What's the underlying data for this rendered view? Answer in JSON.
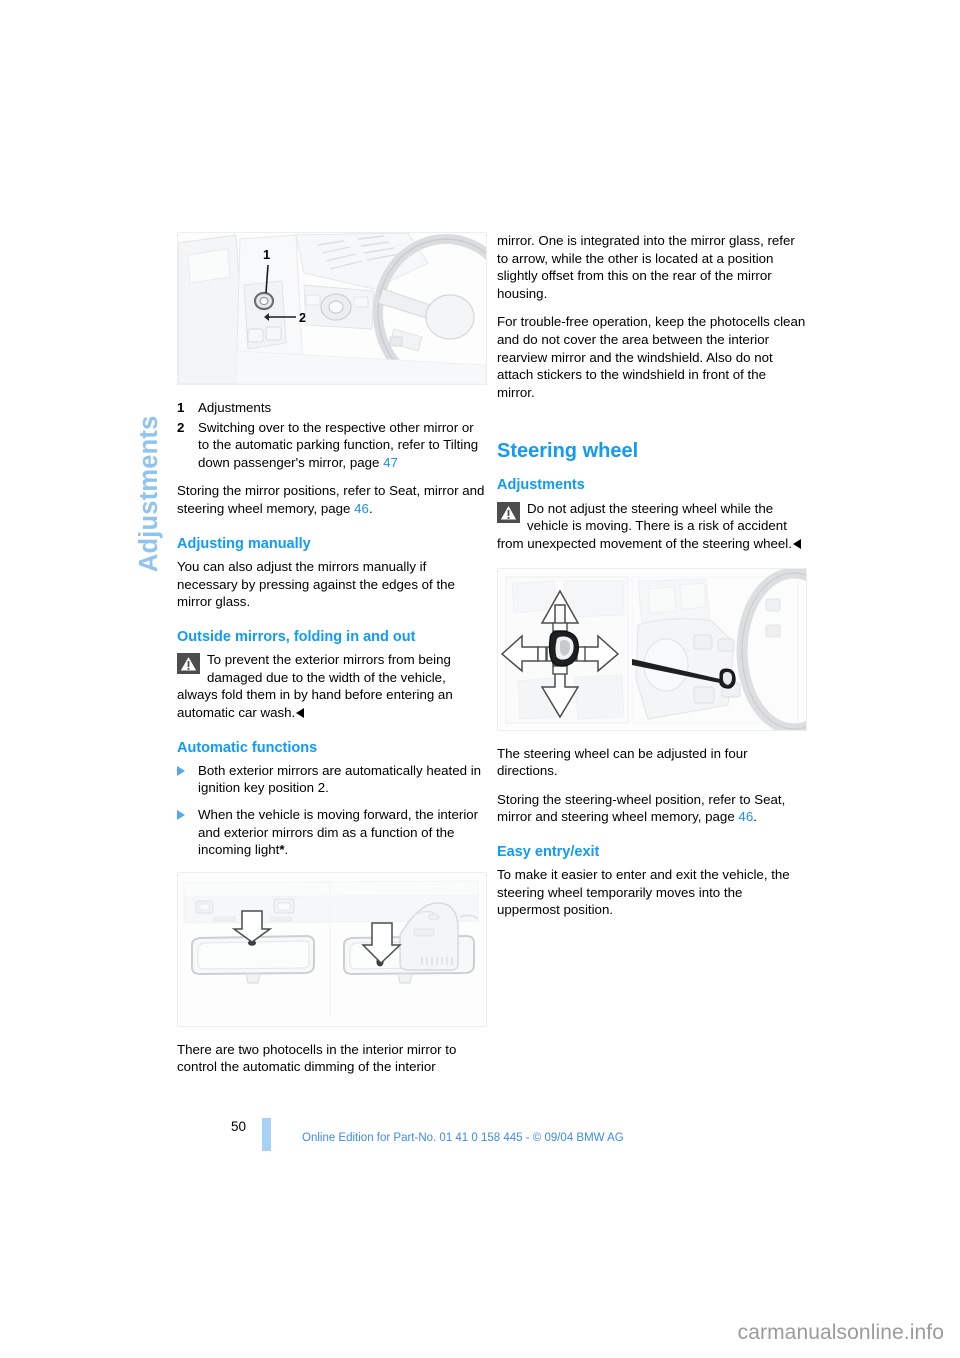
{
  "chapter": {
    "tab_label": "Adjustments"
  },
  "figures": {
    "mirror_controls": {
      "name": "mirror-control-switch-illustration",
      "callout_1": "1",
      "callout_2": "2",
      "watermark": ""
    },
    "steering_wheel_adjust": {
      "name": "steering-wheel-adjustment-illustration",
      "watermark": ""
    },
    "interior_mirror_photocells": {
      "name": "interior-mirror-photocells-illustration",
      "watermark": ""
    }
  },
  "left_column": {
    "legend": [
      {
        "num": "1",
        "text": "Adjustments"
      },
      {
        "num": "2",
        "text": "Switching over to the respective other mirror or to the automatic parking function, refer to Tilting down passenger's mirror, page ",
        "pageref": "47",
        "tail": ""
      }
    ],
    "storing_paragraph": {
      "before": "Storing the mirror positions, refer to Seat, mirror and steering wheel memory, page ",
      "pageref": "46",
      "after": "."
    },
    "adjusting_manually": {
      "heading": "Adjusting manually",
      "body": "You can also adjust the mirrors manually if necessary by pressing against the edges of the mirror glass."
    },
    "outside_mirrors": {
      "heading": "Outside mirrors, folding in and out",
      "warning": "To prevent the exterior mirrors from being damaged due to the width of the vehicle, always fold them in by hand before entering an automatic car wash."
    },
    "automatic_functions": {
      "heading": "Automatic functions",
      "items": [
        "Both exterior mirrors are automatically heated in ignition key position 2.",
        "When the vehicle is moving forward, the interior and exterior mirrors dim as a function of the incoming light"
      ],
      "item2_asterisk": "*",
      "item2_tail": "."
    },
    "photocells_paragraph": "There are two photocells in the interior mirror to control the automatic dimming of the interior"
  },
  "right_column": {
    "continued_paragraph": "mirror. One is integrated into the mirror glass, refer to arrow, while the other is located at a position slightly offset from this on the rear of the mirror housing.",
    "trouble_free_paragraph": "For trouble-free operation, keep the photocells clean and do not cover the area between the interior rearview mirror and the windshield. Also do not attach stickers to the windshield in front of the mirror.",
    "steering_wheel": {
      "heading": "Steering wheel",
      "adjustments_heading": "Adjustments",
      "warning": "Do not adjust the steering wheel while the vehicle is moving. There is a risk of accident from unexpected movement of the steering wheel.",
      "four_directions": "The steering wheel can be adjusted in four directions.",
      "storing": {
        "before": "Storing the steering-wheel position, refer to Seat, mirror and steering wheel memory, page ",
        "pageref": "46",
        "after": "."
      },
      "easy_entry": {
        "heading": "Easy entry/exit",
        "body": "To make it easier to enter and exit the vehicle, the steering wheel temporarily moves into the uppermost position."
      }
    }
  },
  "footer": {
    "page_number": "50",
    "note": "Online Edition for Part-No. 01 41 0 158 445 - © 09/04 BMW AG"
  },
  "watermark": {
    "site": "carmanualsonline.info"
  },
  "colors": {
    "heading_blue": "#109bf5",
    "tab_blue": "#8fc4f0",
    "link_blue": "#1a8ff0",
    "footer_blue": "#3d8bea",
    "footer_bar": "#a7d2f5"
  }
}
